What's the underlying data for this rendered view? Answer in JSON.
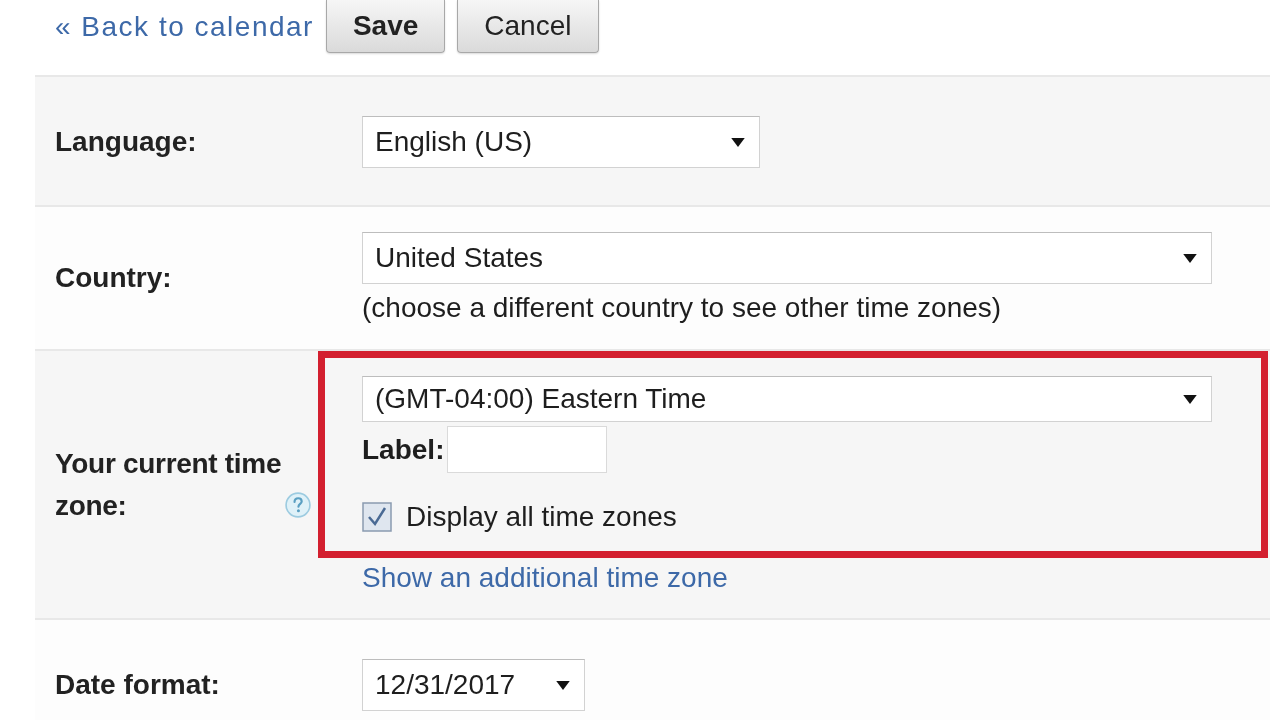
{
  "toolbar": {
    "back_link": "« Back to calendar",
    "buttons": [
      {
        "label": "Save",
        "kind": "primary"
      },
      {
        "label": "Cancel",
        "kind": "default"
      }
    ]
  },
  "settings": [
    {
      "kind": "select",
      "label": "Language:",
      "value": "English (US)"
    },
    {
      "kind": "select",
      "label": "Country:",
      "value": "United States",
      "note": "(choose a different country to see other time zones)"
    },
    {
      "kind": "time_zone",
      "label": "Your current time zone:",
      "value": "(GMT-04:00) Eastern Time",
      "field_label": "Label:",
      "checkbox": {
        "label": "Display all time zones",
        "checked": true
      },
      "link": "Show an additional time zone",
      "highlighted": true
    },
    {
      "kind": "select",
      "label": "Date format:",
      "value": "12/31/2017"
    }
  ]
}
